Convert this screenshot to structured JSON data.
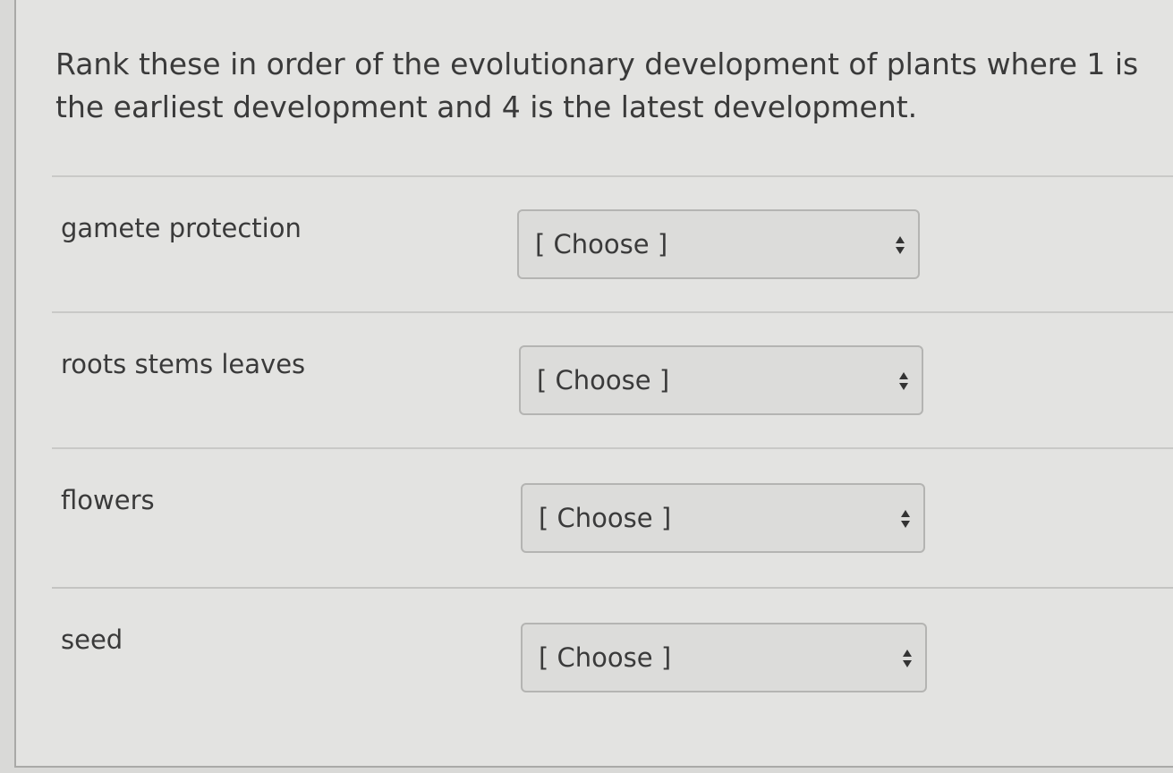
{
  "question": {
    "text": "Rank these in order of the evolutionary development of plants where  1 is the earliest development and 4  is the latest development."
  },
  "rows": [
    {
      "label": "gamete protection",
      "selected": "[ Choose ]"
    },
    {
      "label": "roots stems leaves",
      "selected": "[ Choose ]"
    },
    {
      "label": "flowers",
      "selected": "[ Choose ]"
    },
    {
      "label": "seed",
      "selected": "[ Choose ]"
    }
  ],
  "icons": {
    "select_caret": "up-down-caret-icon"
  },
  "colors": {
    "background": "#e3e3e1",
    "text": "#3a3a3a",
    "select_background": "#dcdcda",
    "select_border": "#b4b4b2"
  }
}
